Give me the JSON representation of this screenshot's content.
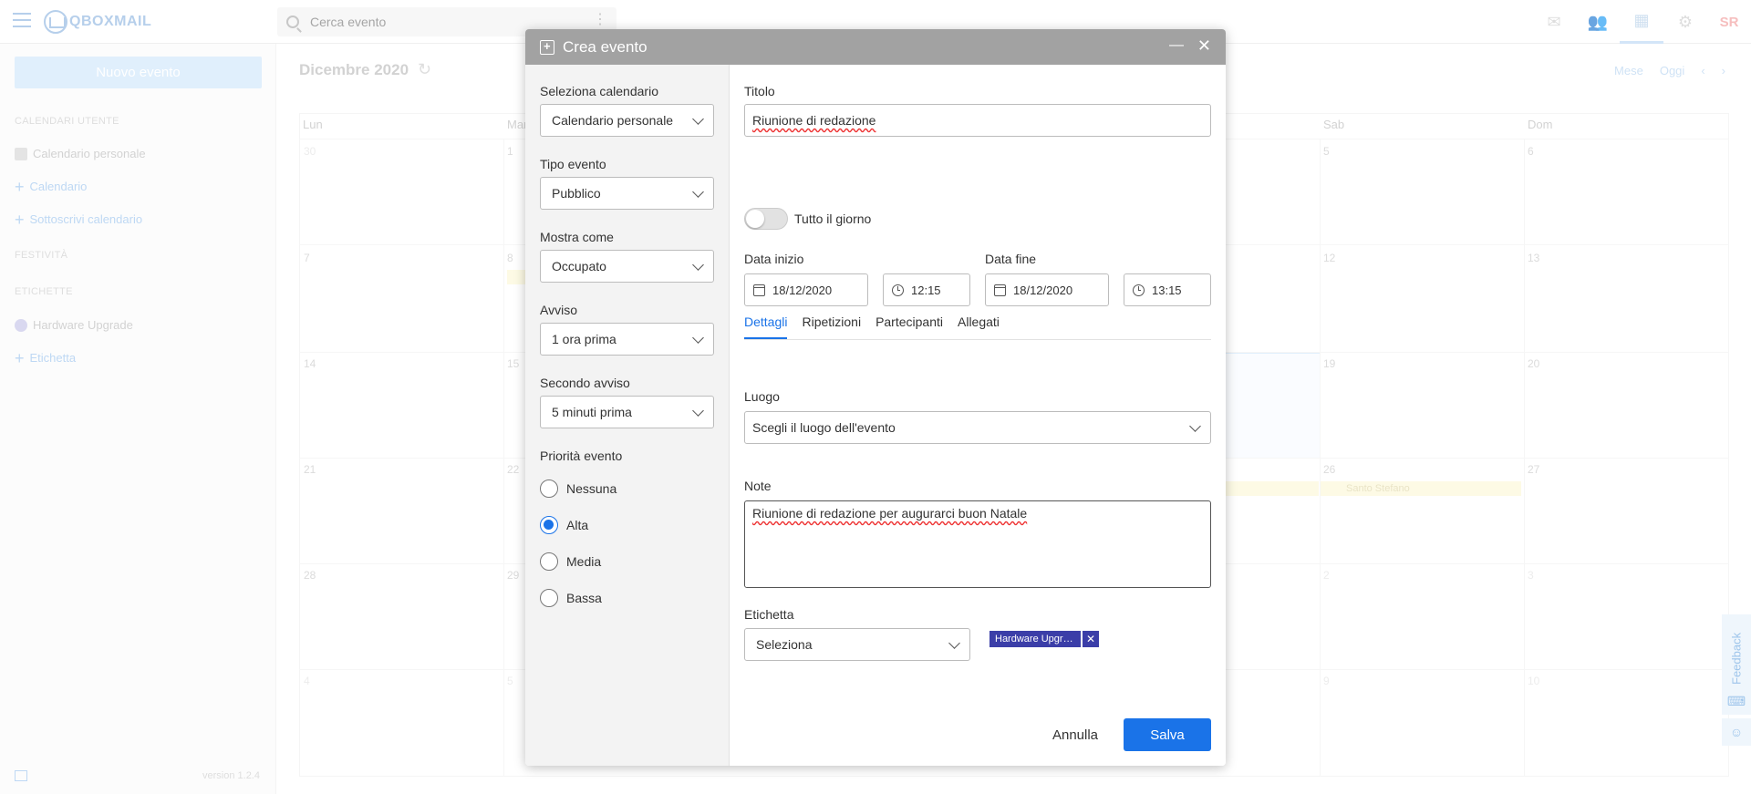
{
  "app": {
    "logo_text": "QBOXMAIL"
  },
  "search": {
    "placeholder": "Cerca evento"
  },
  "user": {
    "initials": "SR"
  },
  "sidebar": {
    "new_event": "Nuovo evento",
    "section_user_calendars": "CALENDARI UTENTE",
    "personal_calendar": "Calendario personale",
    "add_calendar": "Calendario",
    "subscribe_calendar": "Sottoscrivi calendario",
    "section_holidays": "FESTIVITÀ",
    "section_labels": "ETICHETTE",
    "label_item": "Hardware Upgrade",
    "add_label": "Etichetta",
    "version": "version 1.2.4"
  },
  "calendar": {
    "month": "Dicembre 2020",
    "view": "Mese",
    "today": "Oggi",
    "day_headers": [
      "Lun",
      "Mar",
      "Sab",
      "Dom"
    ],
    "holiday": "Santo Stefano",
    "visible_numbers": {
      "row1": [
        "30",
        "1",
        "5",
        "6"
      ],
      "row2": [
        "7",
        "8",
        "12",
        "13"
      ],
      "row3": [
        "14",
        "15",
        "19",
        "20"
      ],
      "row4": [
        "21",
        "22",
        "26",
        "27"
      ],
      "row5": [
        "28",
        "29",
        "2",
        "3"
      ],
      "row6": [
        "4",
        "5",
        "9",
        "10"
      ]
    }
  },
  "side_tabs": {
    "feedback": "Feedback"
  },
  "modal": {
    "title": "Crea evento",
    "left": {
      "select_calendar_label": "Seleziona calendario",
      "select_calendar_value": "Calendario personale",
      "event_type_label": "Tipo evento",
      "event_type_value": "Pubblico",
      "show_as_label": "Mostra come",
      "show_as_value": "Occupato",
      "alert_label": "Avviso",
      "alert_value": "1 ora prima",
      "second_alert_label": "Secondo avviso",
      "second_alert_value": "5 minuti prima",
      "priority_label": "Priorità evento",
      "priority_options": [
        "Nessuna",
        "Alta",
        "Media",
        "Bassa"
      ],
      "priority_selected": "Alta"
    },
    "right": {
      "title_label": "Titolo",
      "title_value": "Riunione di redazione",
      "all_day_label": "Tutto il giorno",
      "all_day_on": false,
      "start_label": "Data inizio",
      "start_date": "18/12/2020",
      "start_time": "12:15",
      "end_label": "Data fine",
      "end_date": "18/12/2020",
      "end_time": "13:15",
      "tabs": [
        "Dettagli",
        "Ripetizioni",
        "Partecipanti",
        "Allegati"
      ],
      "active_tab": "Dettagli",
      "location_label": "Luogo",
      "location_placeholder": "Scegli il luogo dell'evento",
      "notes_label": "Note",
      "notes_value": "Riunione di redazione per augurarci buon Natale",
      "tag_label": "Etichetta",
      "tag_select": "Seleziona",
      "tag_chip": "Hardware Upgr…",
      "cancel": "Annulla",
      "save": "Salva"
    }
  },
  "colors": {
    "accent": "#1a73e8",
    "modal_header": "#a2a2a2",
    "tag": "#3b3ea8"
  }
}
